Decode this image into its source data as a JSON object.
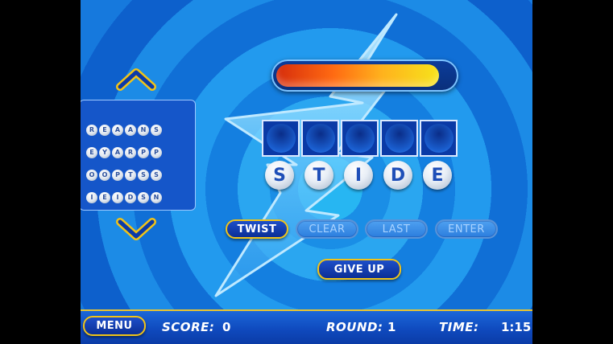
{
  "progress": {
    "fraction": 0.92
  },
  "slots": {
    "count": 5
  },
  "balls": [
    {
      "letter": "S"
    },
    {
      "letter": "T"
    },
    {
      "letter": "I"
    },
    {
      "letter": "D"
    },
    {
      "letter": "E"
    }
  ],
  "puzzles": [
    {
      "letters": [
        "R",
        "E",
        "A",
        "A",
        "N",
        "S"
      ]
    },
    {
      "letters": [
        "E",
        "Y",
        "A",
        "R",
        "P",
        "P"
      ]
    },
    {
      "letters": [
        "O",
        "O",
        "P",
        "T",
        "S",
        "S"
      ]
    },
    {
      "letters": [
        "I",
        "E",
        "I",
        "D",
        "S",
        "N"
      ]
    }
  ],
  "buttons": {
    "twist": "TWIST",
    "clear": "CLEAR",
    "last": "LAST",
    "enter": "ENTER",
    "give_up": "GIVE UP",
    "menu": "MENU"
  },
  "hud": {
    "score_label": "SCORE:",
    "score_value": "0",
    "round_label": "ROUND:",
    "round_value": "1",
    "time_label": "TIME:",
    "time_value": "1:15"
  },
  "colors": {
    "accent": "#f2c417",
    "button_blue": "#0b2f96",
    "disabled_text": "#a9d3ff"
  }
}
